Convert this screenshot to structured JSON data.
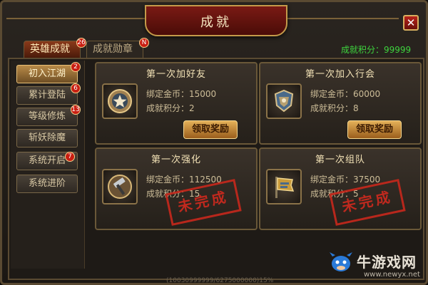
{
  "window": {
    "title": "成就"
  },
  "tabs": [
    {
      "label": "英雄成就",
      "badge": "26",
      "active": true
    },
    {
      "label": "成就勋章",
      "badge": "N",
      "active": false
    }
  ],
  "score": {
    "label": "成就积分：99999"
  },
  "sidebar": {
    "items": [
      {
        "label": "初入江湖",
        "badge": "2",
        "active": true
      },
      {
        "label": "累计登陆",
        "badge": "6",
        "active": false
      },
      {
        "label": "等级修炼",
        "badge": "13",
        "active": false
      },
      {
        "label": "斩妖除魔",
        "badge": "",
        "active": false
      },
      {
        "label": "系统开启",
        "badge": "7",
        "active": false
      },
      {
        "label": "系统进阶",
        "badge": "",
        "active": false
      }
    ]
  },
  "cards": [
    {
      "title": "第一次加好友",
      "gold": "绑定金币：15000",
      "points": "成就积分：2",
      "completed": true,
      "button": "领取奖励",
      "stamp": "",
      "icon": "star-medal-icon"
    },
    {
      "title": "第一次加入行会",
      "gold": "绑定金币：60000",
      "points": "成就积分：8",
      "completed": true,
      "button": "领取奖励",
      "stamp": "",
      "icon": "guild-crest-icon"
    },
    {
      "title": "第一次强化",
      "gold": "绑定金币：112500",
      "points": "成就积分：15",
      "completed": false,
      "button": "",
      "stamp": "未完成",
      "icon": "hammer-icon"
    },
    {
      "title": "第一次组队",
      "gold": "绑定金币：37500",
      "points": "成就积分：5",
      "completed": false,
      "button": "",
      "stamp": "未完成",
      "icon": "team-flag-icon"
    }
  ],
  "watermark": {
    "name": "牛游戏网",
    "url": "www.newyx.net"
  },
  "debug": {
    "text": "(10030999999/6275000000)15%"
  },
  "colors": {
    "accent": "#c49a4a",
    "score": "#3ed43e",
    "stamp": "#d02a1e",
    "title_bg": "#7a1a14"
  }
}
